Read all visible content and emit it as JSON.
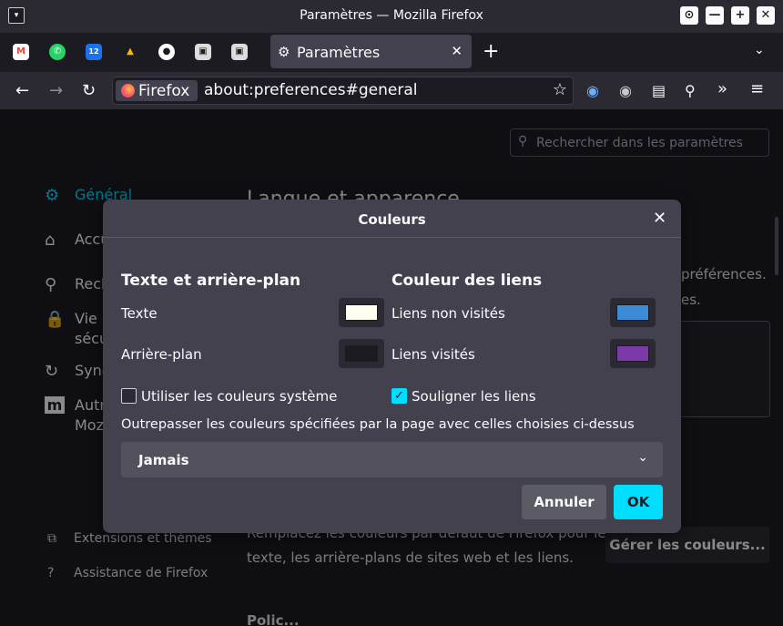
{
  "window": {
    "title": "Paramètres — Mozilla Firefox",
    "menu_glyph": "▾",
    "controls": [
      "⊙",
      "—",
      "+",
      "✕"
    ]
  },
  "tabs": {
    "pinned": [
      "M",
      "✆",
      "12",
      "▲",
      "●",
      "▣",
      "▣"
    ],
    "active_label": "Paramètres",
    "gear_glyph": "⚙",
    "close_glyph": "✕",
    "new_tab_glyph": "+",
    "list_glyph": "⌄"
  },
  "navbar": {
    "back": "←",
    "forward": "→",
    "reload": "↻",
    "identity_label": "Firefox",
    "url": "about:preferences#general",
    "star": "☆",
    "extensions": [
      "◉",
      "◉",
      "▤",
      "⚲",
      "»",
      "≡"
    ]
  },
  "page": {
    "search_placeholder": "Rechercher dans les paramètres",
    "search_glyph": "⚲",
    "categories": [
      {
        "icon": "⚙",
        "label": "Général"
      },
      {
        "icon": "⌂",
        "label": "Accu"
      },
      {
        "icon": "⚲",
        "label": "Rech"
      },
      {
        "icon": "🔒",
        "label": "Vie p"
      },
      {
        "icon": "↻",
        "label": "Sync"
      },
      {
        "icon": "m",
        "label": "Autr"
      }
    ],
    "category_line2": [
      "sécu",
      "Moz"
    ],
    "footer": [
      {
        "icon": "⧉",
        "label": "Extensions et thèmes"
      },
      {
        "icon": "?",
        "label": "Assistance de Firefox"
      }
    ],
    "heading": "Langue et apparence",
    "right_text_1": "préférences.",
    "right_text_2": "es.",
    "body_line_1": "Remplacez les couleurs par défaut de Firefox pour le",
    "body_line_2": "texte, les arrière-plans de sites web et les liens.",
    "manage_colors": "Gérer les couleurs...",
    "bottom_cut": "Polic..."
  },
  "dialog": {
    "title": "Couleurs",
    "close_glyph": "✕",
    "section_text_bg": "Texte et arrière-plan",
    "section_links": "Couleur des liens",
    "text_label": "Texte",
    "background_label": "Arrière-plan",
    "unvisited_label": "Liens non visités",
    "visited_label": "Liens visités",
    "use_system_label": "Utiliser les couleurs système",
    "use_system_checked": false,
    "underline_label": "Souligner les liens",
    "underline_checked": true,
    "check_glyph": "✓",
    "override_label": "Outrepasser les couleurs spécifiées par la page avec celles choisies ci-dessus",
    "override_value": "Jamais",
    "override_chevron": "⌄",
    "cancel_label": "Annuler",
    "ok_label": "OK",
    "colors": {
      "text": "#fffff0",
      "background": "#1c1b22",
      "unvisited": "#3b8bd6",
      "visited": "#7b3aa8"
    }
  },
  "theme_colors": {
    "accent": "#00ddff",
    "surface": "#42414d",
    "background": "#1c1b22"
  }
}
